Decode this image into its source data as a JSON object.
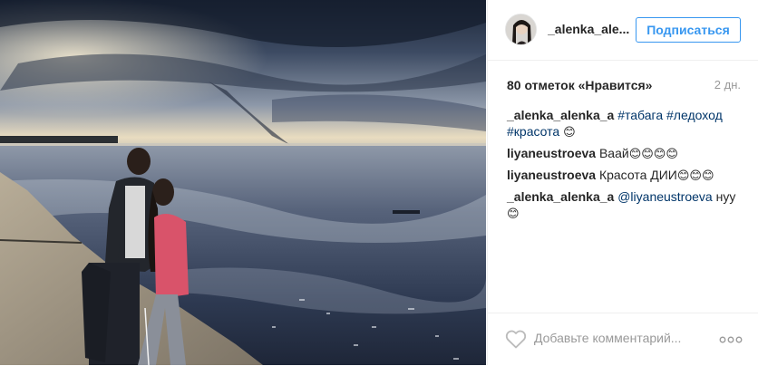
{
  "header": {
    "username": "_alenka_ale...",
    "follow_label": "Подписаться"
  },
  "meta": {
    "likes": "80 отметок «Нравится»",
    "time": "2 дн."
  },
  "comments": [
    {
      "user": "_alenka_alenka_a",
      "parts": [
        "#табага",
        "#ледоход",
        "#красота"
      ],
      "emoji": "😊"
    },
    {
      "user": "liyaneustroeva",
      "text": "Ваай",
      "emoji": "😊😊😊😊"
    },
    {
      "user": "liyaneustroeva",
      "text": "Красота ДИИ",
      "emoji": "😊😊😊"
    },
    {
      "user": "_alenka_alenka_a",
      "mention": "@liyaneustroeva",
      "text": "нуу",
      "emoji": "😊"
    }
  ],
  "footer": {
    "comment_placeholder": "Добавьте комментарий...",
    "like_icon": "heart-outline-icon",
    "more_icon": "ellipsis-icon"
  },
  "colors": {
    "accent": "#3897f0",
    "link": "#003569",
    "muted": "#999999"
  }
}
